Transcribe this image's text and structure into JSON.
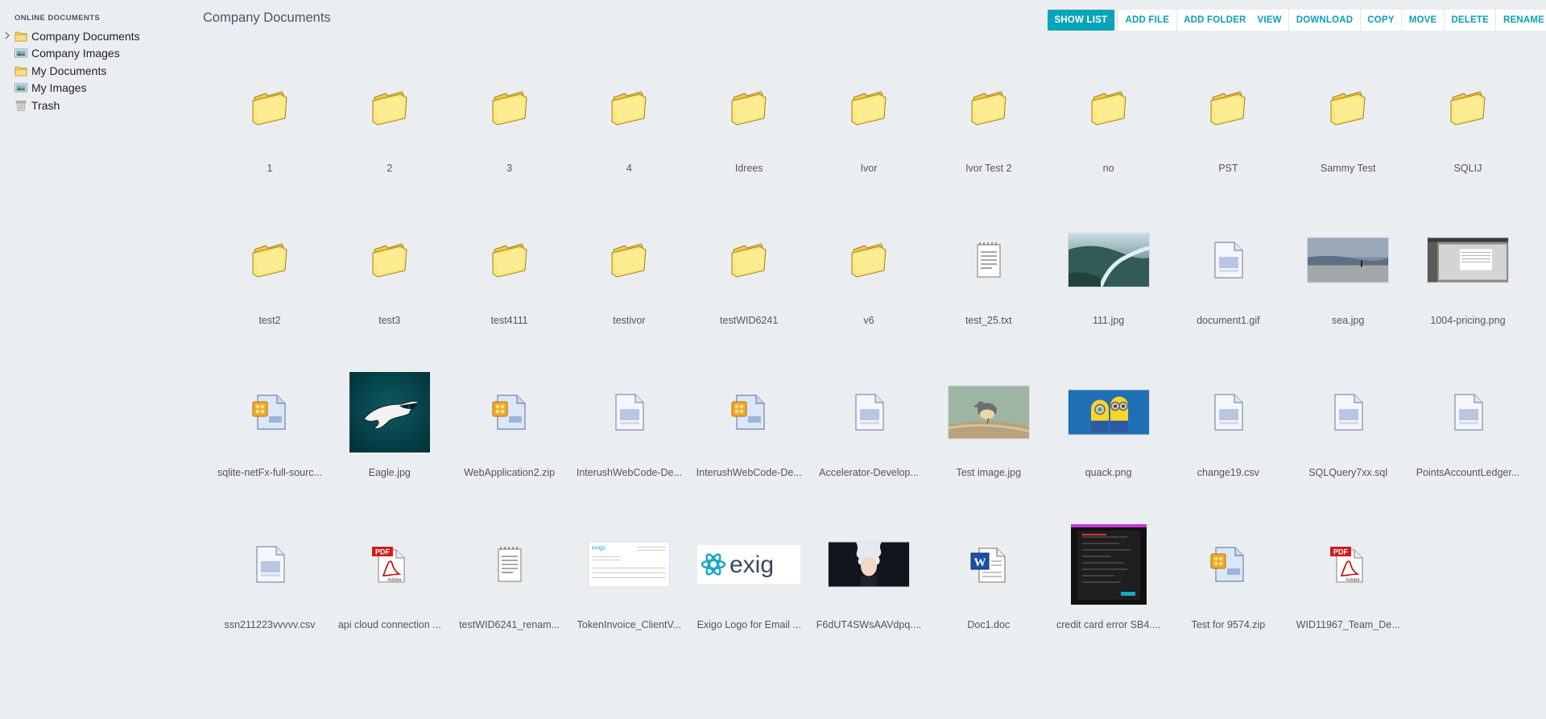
{
  "sidebar": {
    "heading": "ONLINE DOCUMENTS",
    "items": [
      {
        "label": "Company Documents",
        "icon": "folder-icon",
        "expandable": true
      },
      {
        "label": "Company Images",
        "icon": "image-folder-icon"
      },
      {
        "label": "My Documents",
        "icon": "folder-icon"
      },
      {
        "label": "My Images",
        "icon": "image-folder-icon"
      },
      {
        "label": "Trash",
        "icon": "trash-icon"
      }
    ]
  },
  "page_title": "Company Documents",
  "toolbar": {
    "show_list": "SHOW LIST",
    "add_file": "ADD FILE",
    "add_folder": "ADD FOLDER",
    "view": "VIEW",
    "download": "DOWNLOAD",
    "copy": "COPY",
    "move": "MOVE",
    "delete": "DELETE",
    "rename": "RENAME"
  },
  "colors": {
    "accent": "#0aa4b8",
    "background": "#ebeef1",
    "title": "#46586a"
  },
  "files": [
    {
      "name": "1",
      "icon": "folder-icon"
    },
    {
      "name": "2",
      "icon": "folder-icon"
    },
    {
      "name": "3",
      "icon": "folder-icon"
    },
    {
      "name": "4",
      "icon": "folder-icon"
    },
    {
      "name": "Idrees",
      "icon": "folder-icon"
    },
    {
      "name": "Ivor",
      "icon": "folder-icon"
    },
    {
      "name": "Ivor Test 2",
      "icon": "folder-icon"
    },
    {
      "name": "no",
      "icon": "folder-icon"
    },
    {
      "name": "PST",
      "icon": "folder-icon"
    },
    {
      "name": "Sammy Test",
      "icon": "folder-icon"
    },
    {
      "name": "SQLIJ",
      "icon": "folder-icon"
    },
    {
      "name": "test2",
      "icon": "folder-icon"
    },
    {
      "name": "test3",
      "icon": "folder-icon"
    },
    {
      "name": "test4111",
      "icon": "folder-icon"
    },
    {
      "name": "testivor",
      "icon": "folder-icon"
    },
    {
      "name": "testWID6241",
      "icon": "folder-icon"
    },
    {
      "name": "v6",
      "icon": "folder-icon"
    },
    {
      "name": "test_25.txt",
      "icon": "text-file-icon"
    },
    {
      "name": "111.jpg",
      "icon": "river-photo-thumbnail"
    },
    {
      "name": "document1.gif",
      "icon": "generic-file-icon"
    },
    {
      "name": "sea.jpg",
      "icon": "beach-photo-thumbnail"
    },
    {
      "name": "1004-pricing.png",
      "icon": "screenshot-thumbnail"
    },
    {
      "name": "sqlite-netFx-full-sourc...",
      "icon": "zip-file-icon"
    },
    {
      "name": "Eagle.jpg",
      "icon": "eagle-logo-thumbnail"
    },
    {
      "name": "WebApplication2.zip",
      "icon": "zip-file-icon"
    },
    {
      "name": "InterushWebCode-De...",
      "icon": "generic-file-icon"
    },
    {
      "name": "InterushWebCode-De...",
      "icon": "zip-file-icon"
    },
    {
      "name": "Accelerator-Develop...",
      "icon": "generic-file-icon"
    },
    {
      "name": "Test image.jpg",
      "icon": "bird-photo-thumbnail"
    },
    {
      "name": "quack.png",
      "icon": "minions-thumbnail"
    },
    {
      "name": "change19.csv",
      "icon": "generic-file-icon"
    },
    {
      "name": "SQLQuery7xx.sql",
      "icon": "generic-file-icon"
    },
    {
      "name": "PointsAccountLedger...",
      "icon": "generic-file-icon"
    },
    {
      "name": "ssn211223vvvvv.csv",
      "icon": "generic-file-icon"
    },
    {
      "name": "api cloud connection ...",
      "icon": "pdf-file-icon"
    },
    {
      "name": "testWID6241_renam...",
      "icon": "text-file-icon"
    },
    {
      "name": "TokenInvoice_ClientV...",
      "icon": "invoice-thumbnail"
    },
    {
      "name": "Exigo Logo for Email ...",
      "icon": "exigo-logo-thumbnail"
    },
    {
      "name": "F6dUT4SWsAAVdpq....",
      "icon": "anime-thumbnail"
    },
    {
      "name": "Doc1.doc",
      "icon": "word-file-icon"
    },
    {
      "name": "credit card error SB4....",
      "icon": "dark-screenshot-thumbnail"
    },
    {
      "name": "Test for 9574.zip",
      "icon": "zip-file-icon"
    },
    {
      "name": "WID11967_Team_De...",
      "icon": "pdf-file-icon"
    }
  ]
}
